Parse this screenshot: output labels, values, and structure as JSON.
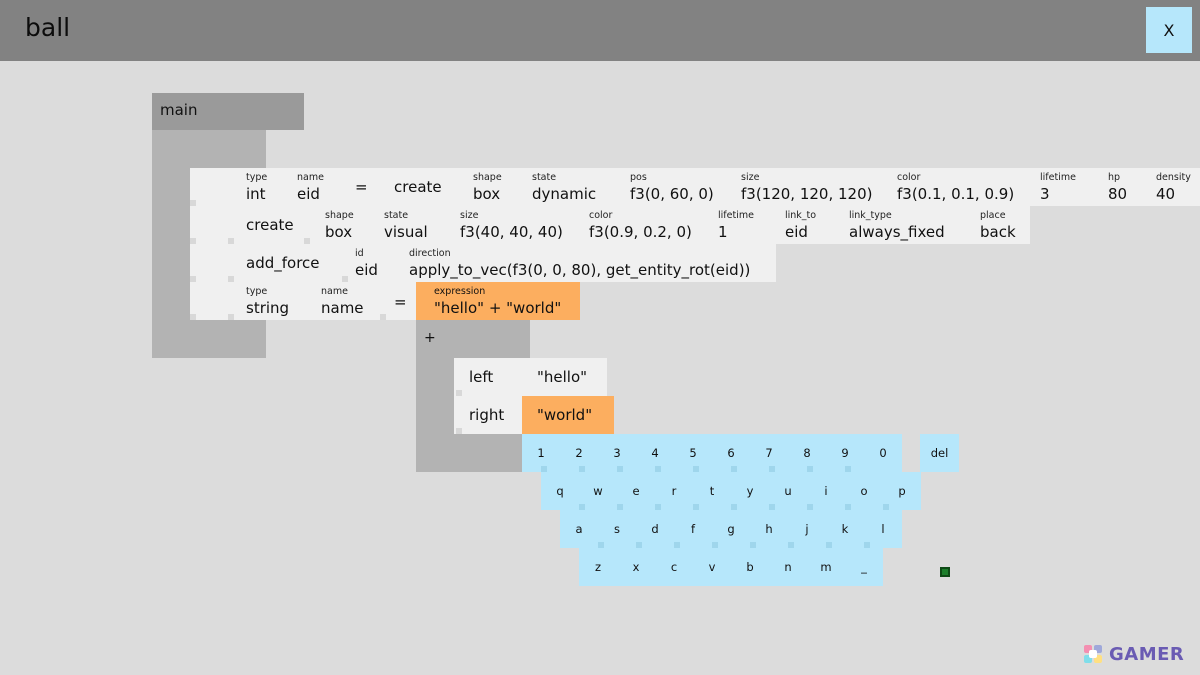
{
  "app": {
    "title": "ball",
    "close_label": "X"
  },
  "main": {
    "label": "main"
  },
  "rows": {
    "r1": {
      "f_type": {
        "label": "type",
        "value": "int"
      },
      "f_name": {
        "label": "name",
        "value": "eid"
      },
      "eq": "=",
      "create": "create",
      "f_shape": {
        "label": "shape",
        "value": "box"
      },
      "f_state": {
        "label": "state",
        "value": "dynamic"
      },
      "f_pos": {
        "label": "pos",
        "value": "f3(0, 60, 0)"
      },
      "f_size": {
        "label": "size",
        "value": "f3(120, 120, 120)"
      },
      "f_color": {
        "label": "color",
        "value": "f3(0.1, 0.1, 0.9)"
      },
      "f_lifetime": {
        "label": "lifetime",
        "value": "3"
      },
      "f_hp": {
        "label": "hp",
        "value": "80"
      },
      "f_density": {
        "label": "density",
        "value": "40"
      }
    },
    "r2": {
      "create": "create",
      "f_shape": {
        "label": "shape",
        "value": "box"
      },
      "f_state": {
        "label": "state",
        "value": "visual"
      },
      "f_size": {
        "label": "size",
        "value": "f3(40, 40, 40)"
      },
      "f_color": {
        "label": "color",
        "value": "f3(0.9, 0.2, 0)"
      },
      "f_lifetime": {
        "label": "lifetime",
        "value": "1"
      },
      "f_link_to": {
        "label": "link_to",
        "value": "eid"
      },
      "f_link_type": {
        "label": "link_type",
        "value": "always_fixed"
      },
      "f_place": {
        "label": "place",
        "value": "back"
      }
    },
    "r3": {
      "add_force": "add_force",
      "f_id": {
        "label": "id",
        "value": "eid"
      },
      "f_direction": {
        "label": "direction",
        "value": "apply_to_vec(f3(0, 0, 80), get_entity_rot(eid))"
      }
    },
    "r4": {
      "f_type": {
        "label": "type",
        "value": "string"
      },
      "f_name": {
        "label": "name",
        "value": "name"
      },
      "eq": "=",
      "f_expression": {
        "label": "expression",
        "value": "\"hello\" + \"world\""
      }
    }
  },
  "operator": {
    "symbol": "+",
    "left": {
      "key": "left",
      "value": "\"hello\""
    },
    "right": {
      "key": "right",
      "value": "\"world\""
    }
  },
  "keyboard": {
    "row1": [
      "1",
      "2",
      "3",
      "4",
      "5",
      "6",
      "7",
      "8",
      "9",
      "0"
    ],
    "row2": [
      "q",
      "w",
      "e",
      "r",
      "t",
      "y",
      "u",
      "i",
      "o",
      "p"
    ],
    "row3": [
      "a",
      "s",
      "d",
      "f",
      "g",
      "h",
      "j",
      "k",
      "l"
    ],
    "row4": [
      "z",
      "x",
      "c",
      "v",
      "b",
      "n",
      "m",
      "_"
    ],
    "del": "del"
  },
  "watermark": {
    "text": "GAMER"
  },
  "colors": {
    "header": "#828282",
    "background": "#dcdcdc",
    "panel_dark": "#b3b3b3",
    "row_bg": "#f0f0f0",
    "highlight_orange": "#fcae5f",
    "keyboard_blue": "#b6e7fb",
    "cursor_green": "#1c7f2b"
  }
}
